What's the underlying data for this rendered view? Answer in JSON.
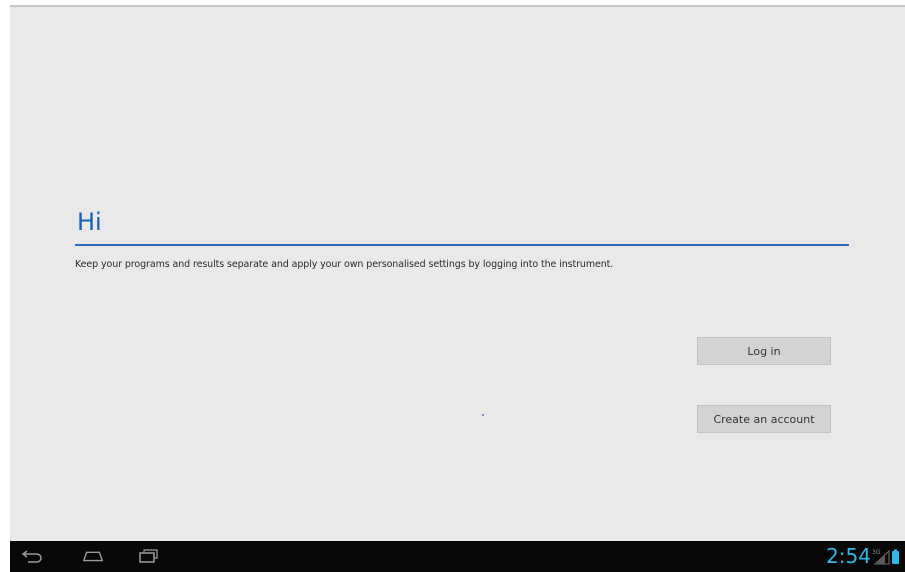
{
  "greeting": "Hi",
  "message": "Keep your programs and results separate and apply your own personalised settings by logging into the instrument.",
  "buttons": {
    "login": "Log in",
    "create_account": "Create an account"
  },
  "status_bar": {
    "time": "2:54",
    "network": "3G",
    "icons": [
      "signal-icon",
      "battery-icon"
    ]
  },
  "nav_bar": {
    "icons": [
      "back-icon",
      "home-icon",
      "recent-apps-icon"
    ]
  },
  "colors": {
    "accent": "#1a5fb4",
    "divider": "#2b68c2",
    "clock": "#33b5e5",
    "background": "#e9e9e9",
    "navbar": "#080808"
  }
}
